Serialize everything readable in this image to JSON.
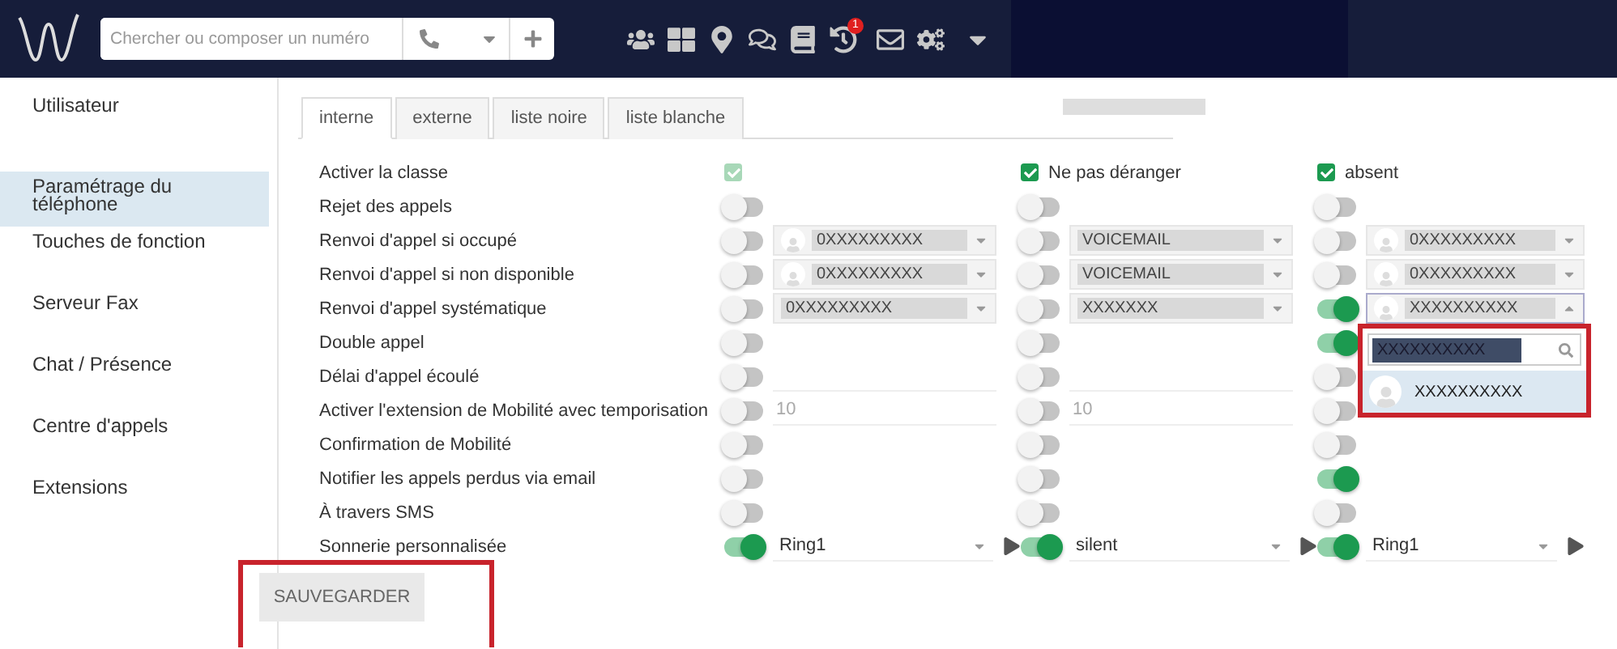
{
  "header": {
    "search": {
      "placeholder": "Chercher ou composer un numéro"
    },
    "notification_count": "1"
  },
  "sidebar": {
    "items": [
      {
        "label": "Utilisateur",
        "selected": false
      },
      {
        "label": "Paramétrage du téléphone",
        "selected": true
      },
      {
        "label": "Touches de fonction",
        "selected": false
      },
      {
        "label": "Serveur Fax",
        "selected": false
      },
      {
        "label": "Chat / Présence",
        "selected": false
      },
      {
        "label": "Centre d'appels",
        "selected": false
      },
      {
        "label": "Extensions",
        "selected": false
      }
    ]
  },
  "tabs": [
    {
      "label": "interne",
      "selected": true
    },
    {
      "label": "externe",
      "selected": false
    },
    {
      "label": "liste noire",
      "selected": false
    },
    {
      "label": "liste blanche",
      "selected": false
    }
  ],
  "rows": [
    {
      "label": "Activer la classe",
      "cells": [
        {
          "kind": "checkbox",
          "checked": true,
          "disabled": true
        },
        {
          "kind": "checkbox",
          "checked": true,
          "disabled": false,
          "label": "Ne pas déranger"
        },
        {
          "kind": "checkbox",
          "checked": true,
          "disabled": false,
          "label": "absent"
        }
      ]
    },
    {
      "label": "Rejet des appels",
      "cells": [
        {
          "kind": "toggle",
          "on": false
        },
        {
          "kind": "toggle",
          "on": false
        },
        {
          "kind": "toggle",
          "on": false
        }
      ]
    },
    {
      "label": "Renvoi d'appel si occupé",
      "cells": [
        {
          "kind": "select",
          "on": false,
          "avatar": true,
          "value": "0XXXXXXXXX"
        },
        {
          "kind": "select",
          "on": false,
          "avatar": false,
          "value": "VOICEMAIL"
        },
        {
          "kind": "select",
          "on": false,
          "avatar": true,
          "value": "0XXXXXXXXX"
        }
      ]
    },
    {
      "label": "Renvoi d'appel si non disponible",
      "cells": [
        {
          "kind": "select",
          "on": false,
          "avatar": true,
          "value": "0XXXXXXXXX"
        },
        {
          "kind": "select",
          "on": false,
          "avatar": false,
          "value": "VOICEMAIL"
        },
        {
          "kind": "select",
          "on": false,
          "avatar": true,
          "value": "0XXXXXXXXX"
        }
      ]
    },
    {
      "label": "Renvoi d'appel systématique",
      "cells": [
        {
          "kind": "select",
          "on": false,
          "avatar": false,
          "value": "0XXXXXXXXX"
        },
        {
          "kind": "select",
          "on": false,
          "avatar": false,
          "value": "XXXXXXX"
        },
        {
          "kind": "select",
          "on": true,
          "avatar": true,
          "open": true,
          "value": "XXXXXXXXXX"
        }
      ]
    },
    {
      "label": "Double appel",
      "cells": [
        {
          "kind": "toggle",
          "on": false
        },
        {
          "kind": "toggle",
          "on": false
        },
        {
          "kind": "toggle",
          "on": true
        }
      ]
    },
    {
      "label": "Délai d'appel écoulé",
      "cells": [
        {
          "kind": "input",
          "on": false
        },
        {
          "kind": "input",
          "on": false
        },
        {
          "kind": "toggle",
          "on": false
        }
      ]
    },
    {
      "label": "Activer l'extension de Mobilité avec temporisation",
      "cells": [
        {
          "kind": "input",
          "on": false,
          "value": "10"
        },
        {
          "kind": "input",
          "on": false,
          "value": "10"
        },
        {
          "kind": "toggle",
          "on": false
        }
      ]
    },
    {
      "label": "Confirmation de Mobilité",
      "cells": [
        {
          "kind": "toggle",
          "on": false
        },
        {
          "kind": "toggle",
          "on": false
        },
        {
          "kind": "toggle",
          "on": false
        }
      ]
    },
    {
      "label": "Notifier les appels perdus via email",
      "cells": [
        {
          "kind": "toggle",
          "on": false
        },
        {
          "kind": "toggle",
          "on": false
        },
        {
          "kind": "toggle",
          "on": true
        }
      ]
    },
    {
      "label": "À travers SMS",
      "cells": [
        {
          "kind": "toggle",
          "on": false
        },
        {
          "kind": "toggle",
          "on": false
        },
        {
          "kind": "toggle",
          "on": false
        }
      ]
    },
    {
      "label": "Sonnerie personnalisée",
      "cells": [
        {
          "kind": "ringtone",
          "on": true,
          "value": "Ring1"
        },
        {
          "kind": "ringtone",
          "on": true,
          "value": "silent"
        },
        {
          "kind": "ringtone",
          "on": true,
          "value": "Ring1"
        }
      ]
    }
  ],
  "dropdown": {
    "search_value": "XXXXXXXXXX",
    "options": [
      "XXXXXXXXXX"
    ]
  },
  "save_button": "SAUVEGARDER"
}
